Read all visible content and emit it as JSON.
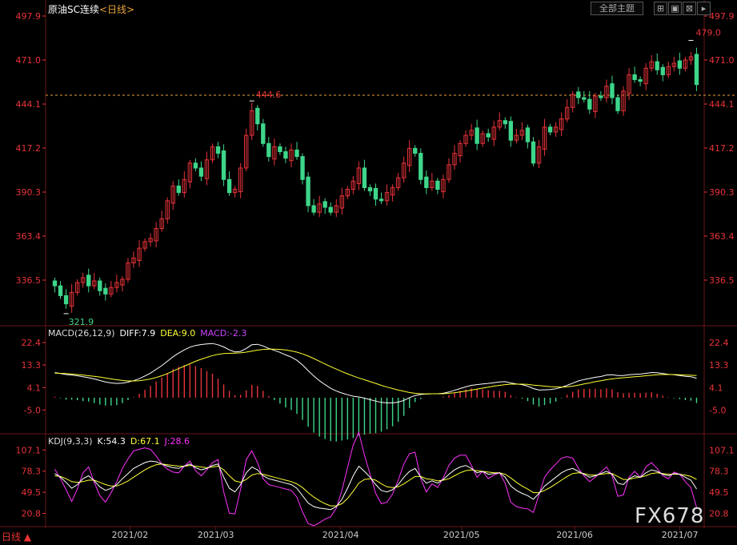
{
  "header": {
    "title": "原油SC连续",
    "period": "<日线>",
    "theme_button": "全部主题",
    "ctrl_icons": [
      "expand-icon",
      "restore-icon",
      "close-icon",
      "forward-icon"
    ]
  },
  "colors": {
    "background": "#000000",
    "up": "#e8333a",
    "down": "#3ed68a",
    "price_axis": "#e8333a",
    "diff_line": "#ffffff",
    "dea_line": "#ffff33",
    "macd_label": "#cc44ff",
    "k_line": "#ffffff",
    "d_line": "#ffff33",
    "j_line": "#ff33ff",
    "grid": "#6a1616",
    "dashed_line": "#e8a23a"
  },
  "macd_label": {
    "name": "MACD(26,12,9)",
    "diff": "DIFF:7.9",
    "dea": "DEA:9.0",
    "macd": "MACD:-2.3"
  },
  "kdj_label": {
    "name": "KDJ(9,3,3)",
    "k": "K:54.3",
    "d": "D:67.1",
    "j": "J:28.6"
  },
  "footer": {
    "tab": "日线 ▲"
  },
  "watermark": "FX678",
  "chart_data": {
    "type": "candlestick",
    "price_axis": {
      "ticks": [
        "497.9",
        "471.0",
        "444.1",
        "417.2",
        "390.3",
        "363.4",
        "336.5"
      ],
      "range": [
        309.6,
        497.9
      ]
    },
    "x_axis_labels": [
      "2021/02",
      "2021/03",
      "2021/04",
      "2021/05",
      "2021/06",
      "2021/07"
    ],
    "annotations": [
      {
        "text": "479.0",
        "type": "high"
      },
      {
        "text": "444.6",
        "type": "local-high"
      },
      {
        "text": "321.9",
        "type": "low"
      }
    ],
    "reference_line": 449.5,
    "candles_close": [
      333,
      327,
      322,
      329,
      335,
      338,
      333,
      336,
      330,
      328,
      332,
      335,
      337,
      347,
      350,
      356,
      360,
      362,
      368,
      374,
      385,
      394,
      390,
      398,
      408,
      405,
      400,
      410,
      418,
      414,
      398,
      390,
      392,
      405,
      425,
      440,
      432,
      420,
      412,
      418,
      415,
      411,
      416,
      412,
      398,
      382,
      378,
      383,
      381,
      378,
      382,
      388,
      392,
      397,
      405,
      393,
      391,
      386,
      385,
      390,
      393,
      399,
      408,
      417,
      414,
      398,
      393,
      397,
      392,
      398,
      407,
      414,
      420,
      425,
      428,
      420,
      426,
      424,
      430,
      434,
      432,
      422,
      425,
      428,
      421,
      408,
      418,
      430,
      427,
      430,
      435,
      442,
      450,
      448,
      447,
      441,
      449,
      448,
      455,
      448,
      440,
      452,
      462,
      459,
      458,
      466,
      470,
      465,
      462,
      467,
      469,
      466,
      471,
      473,
      456
    ],
    "macd": {
      "axis_ticks": [
        "22.4",
        "13.3",
        "4.1",
        "-5.0"
      ],
      "range": [
        -14,
        25
      ],
      "diff": [
        10.2,
        9.8,
        9.4,
        9.2,
        8.9,
        8.5,
        8.1,
        7.6,
        7.0,
        6.4,
        6.0,
        5.8,
        5.9,
        6.3,
        6.9,
        7.7,
        8.8,
        10.0,
        11.5,
        13.0,
        14.8,
        16.6,
        18.1,
        19.4,
        20.5,
        21.2,
        21.6,
        21.8,
        22.0,
        21.5,
        20.6,
        19.4,
        18.6,
        18.8,
        20.0,
        21.5,
        21.7,
        21.0,
        20.0,
        19.2,
        18.4,
        17.4,
        16.5,
        15.2,
        13.3,
        11.0,
        8.8,
        6.9,
        5.3,
        3.8,
        2.7,
        1.9,
        1.2,
        0.6,
        0.3,
        -0.2,
        -0.8,
        -1.4,
        -1.9,
        -2.1,
        -2.1,
        -1.8,
        -1.1,
        0.0,
        0.9,
        1.3,
        1.5,
        1.6,
        1.6,
        1.8,
        2.3,
        3.0,
        3.7,
        4.4,
        5.0,
        5.3,
        5.6,
        5.8,
        6.1,
        6.4,
        6.5,
        6.0,
        5.6,
        5.3,
        4.7,
        3.7,
        3.1,
        3.2,
        3.3,
        3.6,
        4.2,
        5.0,
        5.9,
        6.8,
        7.4,
        7.8,
        8.3,
        8.6,
        9.2,
        9.3,
        9.0,
        9.0,
        9.3,
        9.5,
        9.6,
        9.9,
        10.2,
        10.1,
        9.8,
        9.5,
        9.3,
        9.0,
        8.7,
        8.5,
        7.9
      ],
      "dea": [
        10.0,
        9.9,
        9.8,
        9.6,
        9.4,
        9.2,
        8.9,
        8.7,
        8.4,
        8.0,
        7.6,
        7.3,
        7.0,
        6.8,
        6.8,
        6.9,
        7.2,
        7.6,
        8.2,
        8.9,
        9.8,
        10.8,
        11.8,
        12.8,
        13.8,
        14.8,
        15.6,
        16.4,
        17.1,
        17.6,
        17.9,
        18.0,
        18.1,
        18.2,
        18.5,
        18.9,
        19.3,
        19.6,
        19.7,
        19.7,
        19.6,
        19.4,
        19.0,
        18.5,
        17.8,
        16.9,
        15.9,
        14.8,
        13.7,
        12.6,
        11.6,
        10.6,
        9.7,
        8.8,
        8.0,
        7.3,
        6.5,
        5.8,
        5.0,
        4.3,
        3.7,
        3.1,
        2.6,
        2.1,
        1.8,
        1.6,
        1.5,
        1.6,
        1.6,
        1.6,
        1.8,
        2.0,
        2.3,
        2.7,
        3.1,
        3.5,
        3.9,
        4.3,
        4.7,
        5.0,
        5.3,
        5.5,
        5.5,
        5.5,
        5.4,
        5.1,
        4.9,
        4.7,
        4.5,
        4.4,
        4.3,
        4.4,
        4.7,
        5.1,
        5.6,
        6.0,
        6.5,
        6.9,
        7.3,
        7.6,
        7.9,
        8.1,
        8.3,
        8.5,
        8.7,
        8.9,
        9.1,
        9.3,
        9.4,
        9.4,
        9.4,
        9.3,
        9.2,
        9.1,
        9.0
      ]
    },
    "kdj": {
      "axis_ticks": [
        "107.1",
        "78.3",
        "49.5",
        "20.8"
      ],
      "range": [
        5,
        115
      ],
      "k": [
        75,
        70,
        63,
        55,
        60,
        68,
        72,
        65,
        57,
        52,
        55,
        60,
        68,
        75,
        82,
        86,
        90,
        92,
        91,
        88,
        85,
        83,
        82,
        85,
        88,
        83,
        80,
        82,
        86,
        88,
        70,
        55,
        50,
        60,
        76,
        84,
        80,
        72,
        68,
        66,
        64,
        62,
        60,
        55,
        45,
        35,
        30,
        28,
        27,
        26,
        30,
        40,
        55,
        72,
        85,
        78,
        70,
        60,
        52,
        50,
        53,
        60,
        70,
        78,
        82,
        70,
        62,
        65,
        62,
        67,
        74,
        80,
        84,
        86,
        82,
        76,
        78,
        74,
        75,
        76,
        70,
        58,
        52,
        48,
        45,
        40,
        48,
        58,
        64,
        70,
        76,
        80,
        82,
        78,
        74,
        70,
        72,
        75,
        78,
        74,
        62,
        60,
        68,
        72,
        70,
        76,
        80,
        78,
        74,
        72,
        75,
        74,
        70,
        66,
        54
      ],
      "d": [
        72,
        71,
        68,
        64,
        63,
        64,
        66,
        66,
        63,
        60,
        58,
        58,
        61,
        65,
        70,
        75,
        80,
        84,
        87,
        88,
        87,
        86,
        85,
        85,
        86,
        85,
        84,
        83,
        84,
        85,
        80,
        72,
        65,
        63,
        67,
        73,
        75,
        74,
        72,
        70,
        68,
        66,
        64,
        61,
        56,
        49,
        43,
        38,
        34,
        31,
        31,
        34,
        41,
        51,
        62,
        67,
        68,
        66,
        61,
        57,
        56,
        57,
        61,
        66,
        71,
        71,
        68,
        67,
        65,
        66,
        68,
        72,
        76,
        79,
        80,
        79,
        78,
        77,
        76,
        76,
        74,
        69,
        63,
        58,
        54,
        49,
        49,
        52,
        56,
        61,
        66,
        71,
        75,
        76,
        75,
        73,
        73,
        74,
        75,
        75,
        71,
        67,
        67,
        69,
        70,
        72,
        75,
        76,
        75,
        74,
        74,
        74,
        73,
        71,
        67
      ],
      "j": [
        81,
        68,
        53,
        37,
        54,
        76,
        84,
        63,
        45,
        36,
        49,
        64,
        82,
        95,
        106,
        108,
        110,
        108,
        99,
        88,
        81,
        77,
        76,
        85,
        92,
        79,
        72,
        80,
        90,
        94,
        50,
        21,
        20,
        54,
        94,
        106,
        90,
        68,
        60,
        58,
        56,
        54,
        52,
        43,
        23,
        7,
        4,
        8,
        13,
        16,
        28,
        52,
        83,
        114,
        131,
        100,
        74,
        48,
        34,
        36,
        47,
        66,
        88,
        102,
        104,
        68,
        50,
        61,
        56,
        69,
        86,
        96,
        100,
        100,
        86,
        70,
        78,
        68,
        73,
        76,
        62,
        36,
        30,
        28,
        27,
        22,
        46,
        70,
        80,
        88,
        96,
        98,
        96,
        82,
        72,
        64,
        70,
        77,
        84,
        72,
        44,
        46,
        70,
        78,
        70,
        84,
        90,
        82,
        72,
        68,
        77,
        74,
        64,
        56,
        29
      ]
    }
  }
}
